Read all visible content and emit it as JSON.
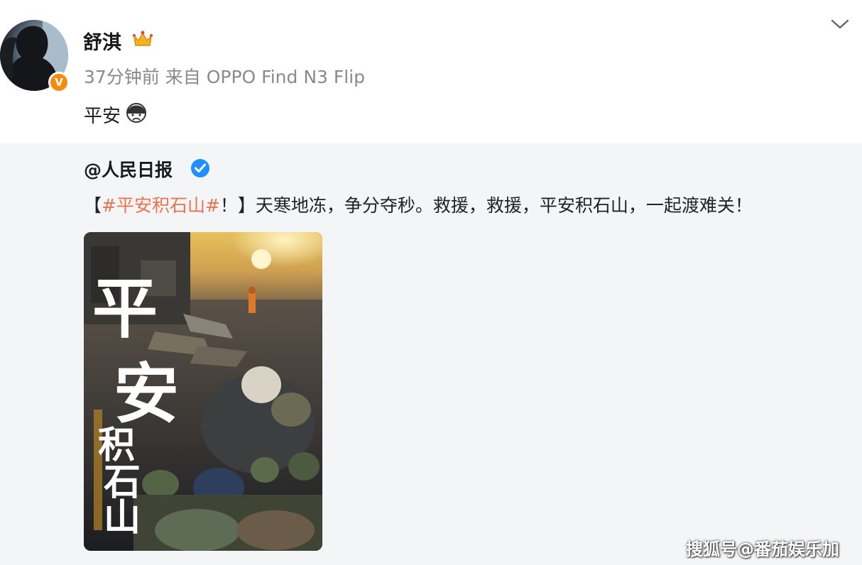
{
  "post": {
    "username": "舒淇",
    "meta": "37分钟前 来自 OPPO Find N3 Flip",
    "text": "平安",
    "icons": {
      "avatar": "avatar-silhouette",
      "badge": "verified-orange-v-icon",
      "crown": "crown-icon",
      "emoji": "sad-face-emoji",
      "more": "chevron-down-icon"
    }
  },
  "repost": {
    "author": "@人民日报",
    "text_open": "【",
    "hashtag": "#平安积石山#",
    "text_rest": "！】天寒地冻，争分夺秒。救援，救援，平安积石山，一起渡难关！",
    "image_title": [
      "平",
      "安",
      "积",
      "石",
      "山"
    ],
    "icons": {
      "verified": "verified-blue-icon"
    }
  },
  "watermark": "搜狐号@番茄娱乐加",
  "colors": {
    "hashtag": "#eb7350",
    "repost_bg": "#f4f5f7",
    "meta_text": "#8a8a8a",
    "badge_orange": "#f58a0c",
    "verified_blue": "#1e90ff"
  }
}
